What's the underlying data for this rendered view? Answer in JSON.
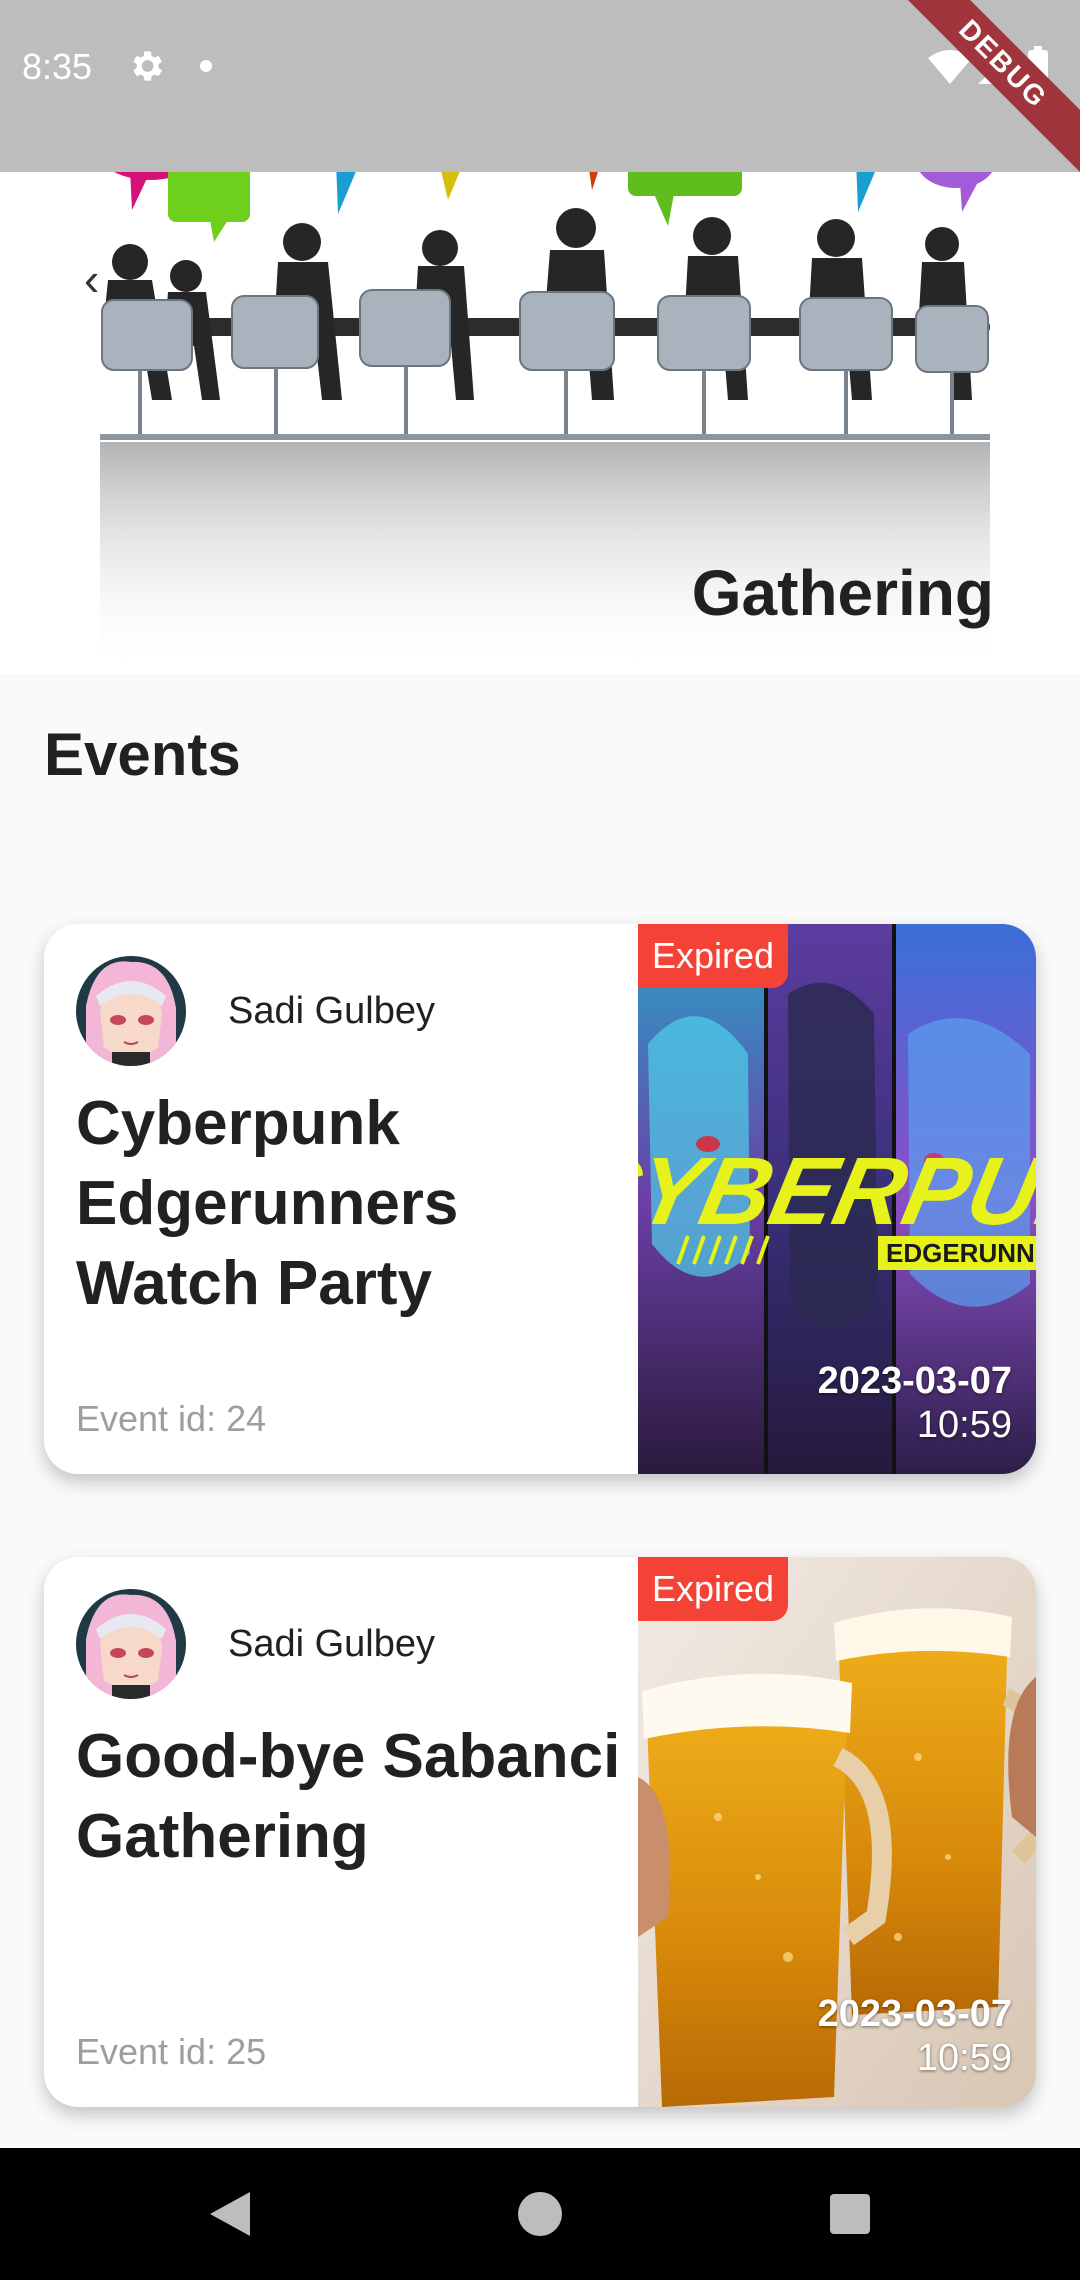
{
  "status_bar": {
    "time": "8:35",
    "debug_label": "DEBUG"
  },
  "header": {
    "title": "Gathering"
  },
  "section_title": "Events",
  "events": [
    {
      "author": "Sadi Gulbey",
      "title": "Cyberpunk Edgerunners Watch Party",
      "id_label": "Event id: 24",
      "badge": "Expired",
      "date": "2023-03-07",
      "time": "10:59",
      "image_text": "CYBERPUNK",
      "image_subtext": "EDGERUNNERS"
    },
    {
      "author": "Sadi Gulbey",
      "title": "Good-bye Sabanci Gathering",
      "id_label": "Event id: 25",
      "badge": "Expired",
      "date": "2023-03-07",
      "time": "10:59"
    }
  ],
  "icons": {
    "settings": "gear-icon",
    "wifi": "wifi-icon",
    "signal": "signal-icon",
    "battery": "battery-icon",
    "back": "back-arrow-icon",
    "nav_back": "nav-back-icon",
    "nav_home": "nav-home-icon",
    "nav_recent": "nav-recent-icon"
  },
  "colors": {
    "badge": "#f44336",
    "debug_banner": "#a0363b",
    "status_bar": "#bdbdbd"
  }
}
